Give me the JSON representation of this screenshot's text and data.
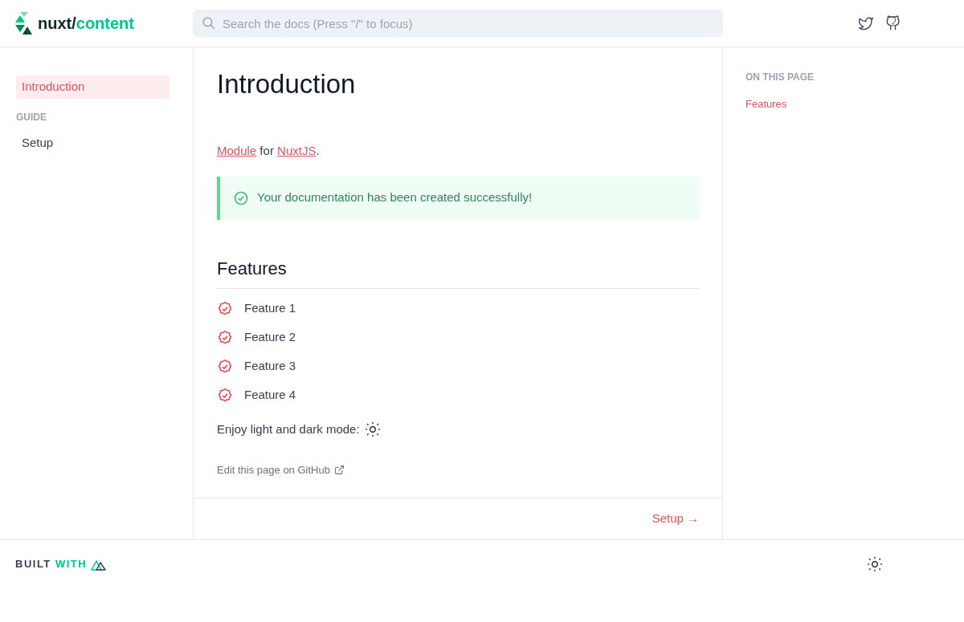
{
  "header": {
    "logo": {
      "prefix": "nuxt/",
      "suffix": "content"
    },
    "search": {
      "placeholder": "Search the docs (Press \"/\" to focus)"
    }
  },
  "sidebar": {
    "items": [
      {
        "kind": "link",
        "label": "Introduction",
        "selected": true
      },
      {
        "kind": "group",
        "label": "GUIDE",
        "children": [
          {
            "label": "Setup",
            "selected": false
          }
        ]
      }
    ]
  },
  "content": {
    "title": "Introduction",
    "intro": [
      {
        "kind": "link",
        "text": "Module"
      },
      {
        "kind": "text",
        "text": " for "
      },
      {
        "kind": "link",
        "text": "NuxtJS"
      },
      {
        "kind": "text",
        "text": "."
      }
    ],
    "alert": {
      "text": "Your documentation has been created successfully!"
    },
    "section_title": "Features",
    "features": [
      "Feature 1",
      "Feature 2",
      "Feature 3",
      "Feature 4"
    ],
    "mode_text": "Enjoy light and dark mode:",
    "edit_link": "Edit this page on GitHub",
    "next_link": "Setup →"
  },
  "toc": {
    "title": "ON THIS PAGE",
    "items": [
      {
        "label": "Features"
      }
    ]
  },
  "footer": {
    "built": "BUILT",
    "with": "WITH"
  }
}
